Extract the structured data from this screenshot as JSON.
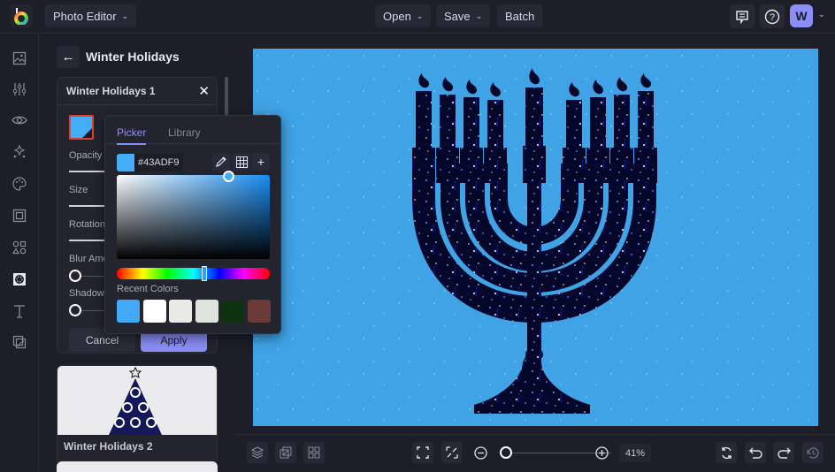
{
  "app": {
    "title": "Photo Editor"
  },
  "topbar": {
    "open_label": "Open",
    "save_label": "Save",
    "batch_label": "Batch",
    "avatar_initial": "W"
  },
  "left_rail": {
    "items": [
      "image-icon",
      "adjust-icon",
      "eye-icon",
      "effects-icon",
      "palette-icon",
      "frame-icon",
      "shapes-icon",
      "overlay-icon",
      "text-icon",
      "graphics-icon"
    ],
    "active": "overlay-icon"
  },
  "panel": {
    "title": "Winter Holidays",
    "card": {
      "title": "Winter Holidays 1",
      "color_value": "#43ADF9",
      "labels": {
        "opacity": "Opacity",
        "size": "Size",
        "rotation": "Rotation",
        "blur": "Blur Amount",
        "shadow": "Shadow"
      },
      "blur_value": 0,
      "shadow_value": 0,
      "cancel_label": "Cancel",
      "apply_label": "Apply"
    },
    "thumbnails": [
      {
        "label": "Winter Holidays 2"
      }
    ]
  },
  "picker": {
    "tabs": [
      {
        "label": "Picker",
        "active": true
      },
      {
        "label": "Library",
        "active": false
      }
    ],
    "hex": "#43ADF9",
    "recent_label": "Recent Colors",
    "recent_colors": [
      "#43a8f7",
      "#ffffff",
      "#e9eae6",
      "#dfe3dd",
      "#0e3210",
      "#6a3a37"
    ]
  },
  "bottombar": {
    "zoom_value": "41%",
    "zoom_fraction": 0.05
  },
  "colors": {
    "accent": "#8b8ef8",
    "canvas_bg": "#3fa3e6",
    "selected_border": "#e0412c"
  }
}
